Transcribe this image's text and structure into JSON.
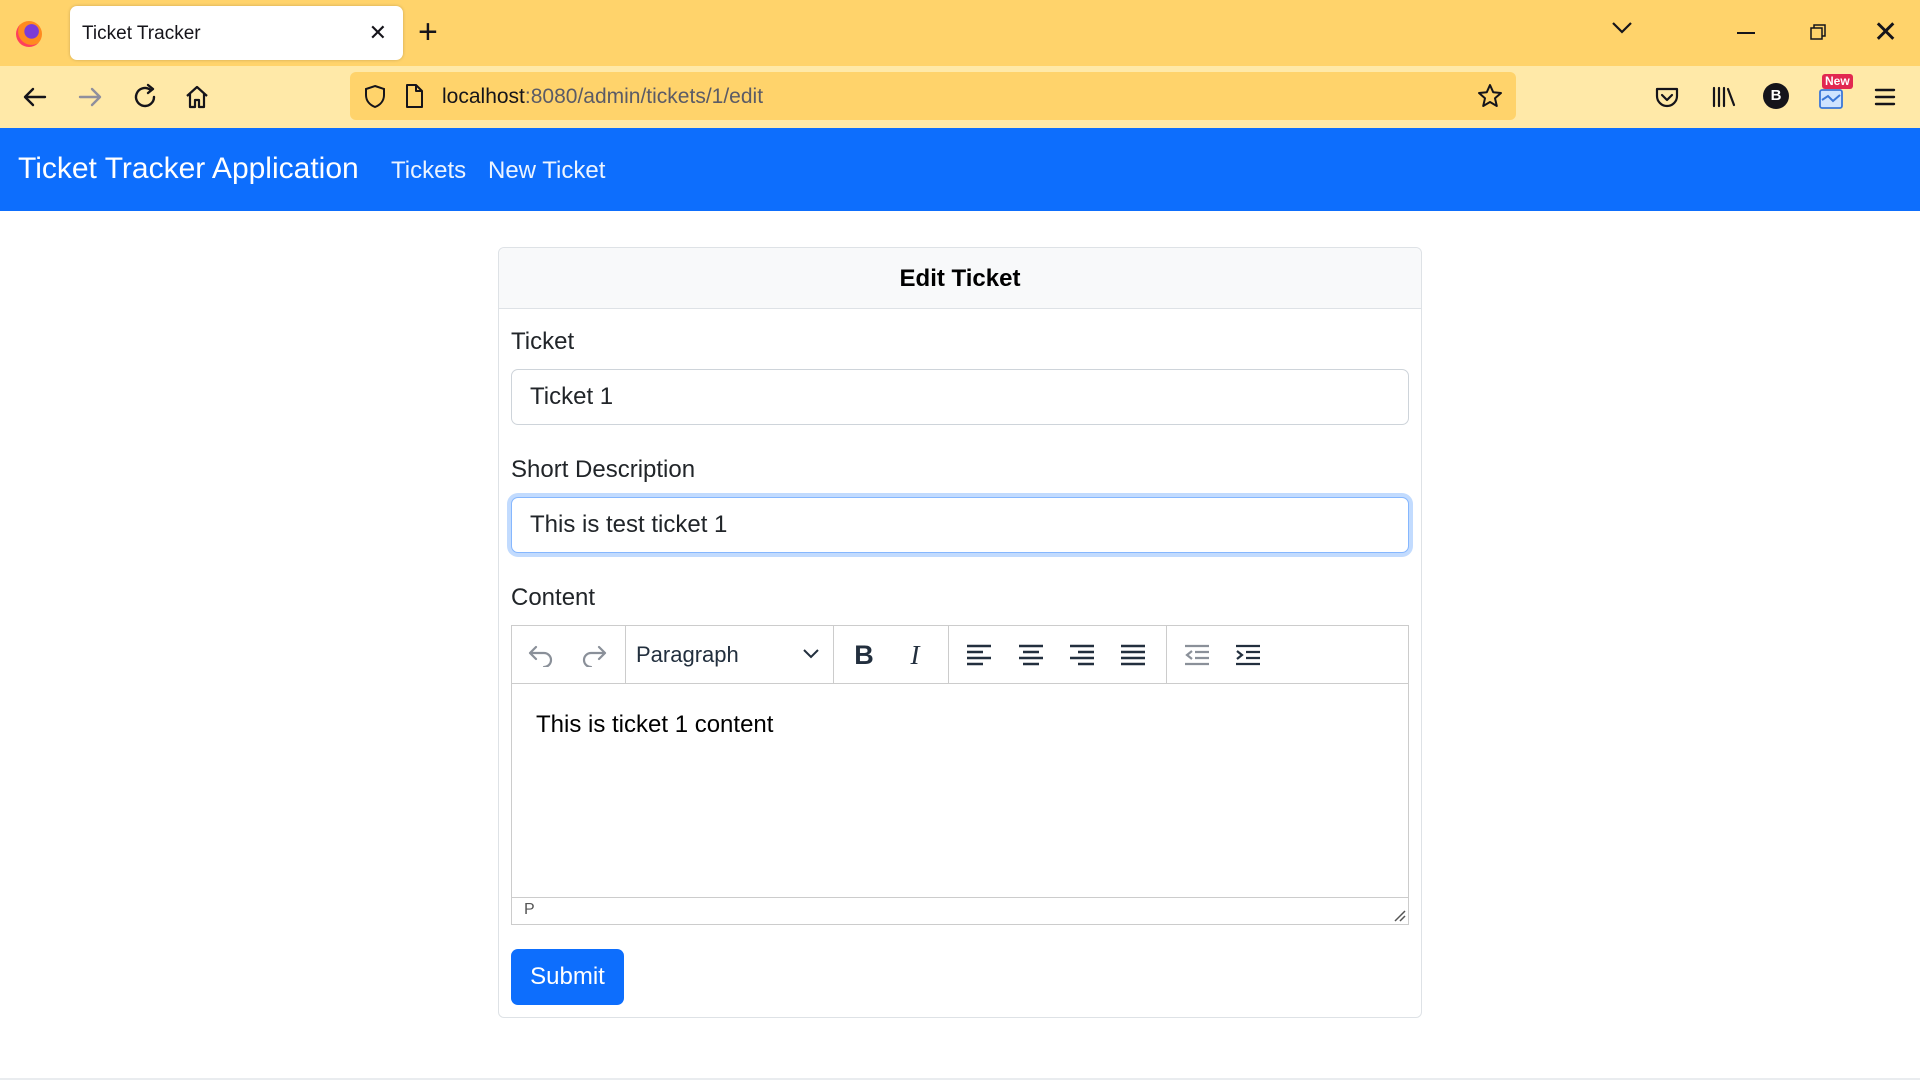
{
  "browser": {
    "tab_title": "Ticket Tracker",
    "tab_close": "✕",
    "new_tab": "+",
    "url_host": "localhost",
    "url_rest": ":8080/admin/tickets/1/edit",
    "badge_new": "New",
    "avatar_letter": "B"
  },
  "app": {
    "brand": "Ticket Tracker Application",
    "nav": {
      "tickets": "Tickets",
      "new_ticket": "New Ticket"
    },
    "accent_color": "#0d6efd"
  },
  "form": {
    "header": "Edit Ticket",
    "ticket_label": "Ticket",
    "ticket_value": "Ticket 1",
    "short_desc_label": "Short Description",
    "short_desc_value": "This is test ticket 1",
    "content_label": "Content",
    "editor": {
      "block_format": "Paragraph",
      "content": "This is ticket 1 content",
      "status_path": "P"
    },
    "submit_label": "Submit"
  }
}
